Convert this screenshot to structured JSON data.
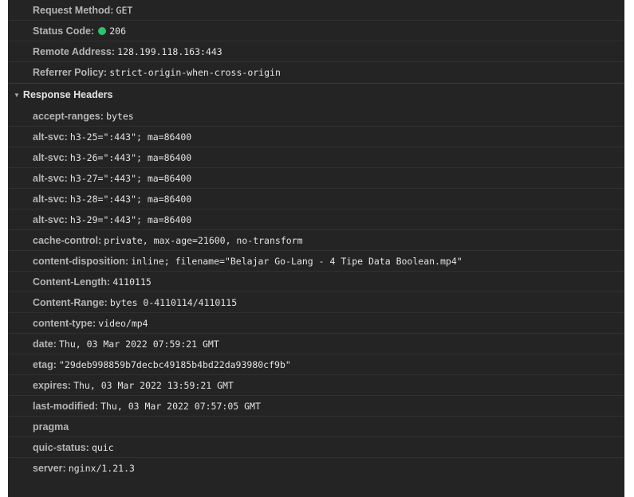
{
  "general": [
    {
      "key": "Request Method:",
      "value": "GET"
    },
    {
      "key": "Status Code:",
      "value": "206",
      "status_color": "#2fc16b"
    },
    {
      "key": "Remote Address:",
      "value": "128.199.118.163:443"
    },
    {
      "key": "Referrer Policy:",
      "value": "strict-origin-when-cross-origin"
    }
  ],
  "response_headers": {
    "title": "Response Headers",
    "expand_icon": "triangle-down",
    "items": [
      {
        "key": "accept-ranges:",
        "value": "bytes"
      },
      {
        "key": "alt-svc:",
        "value": "h3-25=\":443\"; ma=86400"
      },
      {
        "key": "alt-svc:",
        "value": "h3-26=\":443\"; ma=86400"
      },
      {
        "key": "alt-svc:",
        "value": "h3-27=\":443\"; ma=86400"
      },
      {
        "key": "alt-svc:",
        "value": "h3-28=\":443\"; ma=86400"
      },
      {
        "key": "alt-svc:",
        "value": "h3-29=\":443\"; ma=86400"
      },
      {
        "key": "cache-control:",
        "value": "private, max-age=21600, no-transform"
      },
      {
        "key": "content-disposition:",
        "value": "inline; filename=\"Belajar Go-Lang - 4 Tipe Data Boolean.mp4\""
      },
      {
        "key": "Content-Length:",
        "value": "4110115"
      },
      {
        "key": "Content-Range:",
        "value": "bytes 0-4110114/4110115"
      },
      {
        "key": "content-type:",
        "value": "video/mp4"
      },
      {
        "key": "date:",
        "value": "Thu, 03 Mar 2022 07:59:21 GMT"
      },
      {
        "key": "etag:",
        "value": "\"29deb998859b7decbc49185b4bd22da93980cf9b\""
      },
      {
        "key": "expires:",
        "value": "Thu, 03 Mar 2022 13:59:21 GMT"
      },
      {
        "key": "last-modified:",
        "value": "Thu, 03 Mar 2022 07:57:05 GMT"
      },
      {
        "key": "pragma",
        "value": ""
      },
      {
        "key": "quic-status:",
        "value": "quic"
      },
      {
        "key": "server:",
        "value": "nginx/1.21.3"
      }
    ]
  }
}
